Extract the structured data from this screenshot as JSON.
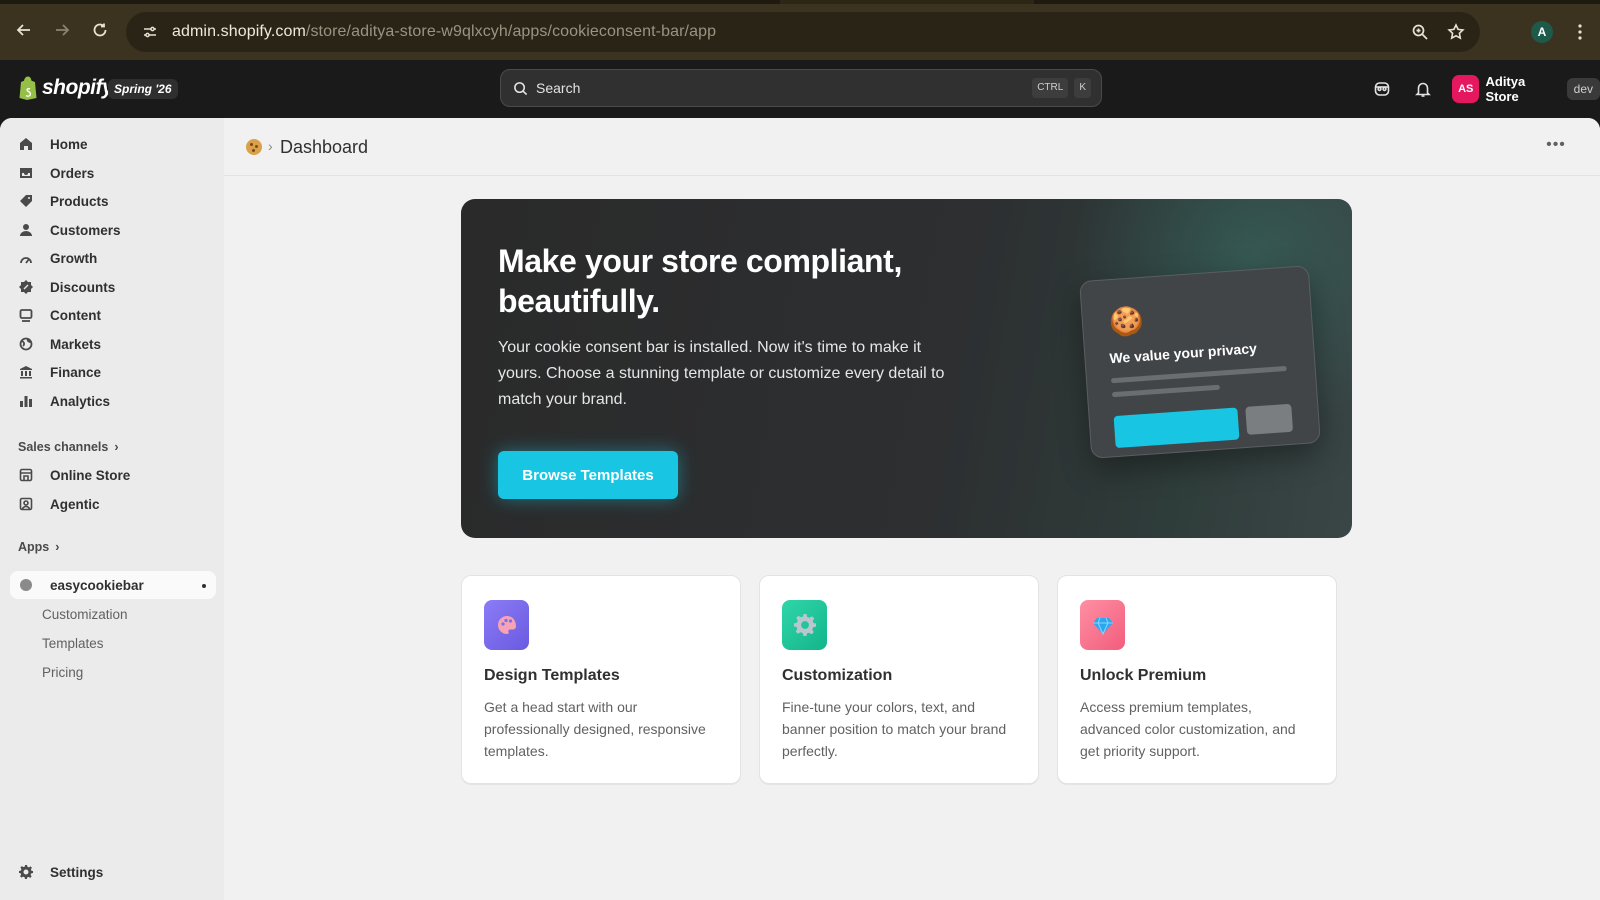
{
  "browser": {
    "url_host": "admin.shopify.com",
    "url_path": "/store/aditya-store-w9qlxcyh/apps/cookieconsent-bar/app",
    "profile_initial": "A"
  },
  "topbar": {
    "logo_text": "shopify",
    "release_badge": "Spring '26",
    "search_placeholder": "Search",
    "shortcut_keys": [
      "CTRL",
      "K"
    ],
    "store_avatar": "AS",
    "store_name": "Aditya Store",
    "store_badge": "dev"
  },
  "sidebar": {
    "items": [
      {
        "label": "Home",
        "icon": "home-icon"
      },
      {
        "label": "Orders",
        "icon": "orders-icon"
      },
      {
        "label": "Products",
        "icon": "tag-icon"
      },
      {
        "label": "Customers",
        "icon": "person-icon"
      },
      {
        "label": "Growth",
        "icon": "growth-icon"
      },
      {
        "label": "Discounts",
        "icon": "discount-icon"
      },
      {
        "label": "Content",
        "icon": "content-icon"
      },
      {
        "label": "Markets",
        "icon": "globe-icon"
      },
      {
        "label": "Finance",
        "icon": "bank-icon"
      },
      {
        "label": "Analytics",
        "icon": "bar-chart-icon"
      }
    ],
    "sales_channels_heading": "Sales channels",
    "sales_channels": [
      {
        "label": "Online Store",
        "icon": "store-icon"
      },
      {
        "label": "Agentic",
        "icon": "agentic-icon"
      }
    ],
    "apps_heading": "Apps",
    "active_app": "easycookiebar",
    "app_subitems": [
      "Customization",
      "Templates",
      "Pricing"
    ],
    "settings_label": "Settings"
  },
  "page": {
    "title": "Dashboard"
  },
  "hero": {
    "heading": "Make your store compliant, beautifully.",
    "body": "Your cookie consent bar is installed. Now it's time to make it yours. Choose a stunning template or customize every detail to match your brand.",
    "cta_label": "Browse Templates",
    "mock_title": "We value your privacy",
    "accent": "#18c6e4"
  },
  "cards": [
    {
      "title": "Design Templates",
      "description": "Get a head start with our professionally designed, responsive templates.",
      "icon": "palette-icon",
      "color": "#7b6cf0"
    },
    {
      "title": "Customization",
      "description": "Fine-tune your colors, text, and banner position to match your brand perfectly.",
      "icon": "gear-icon",
      "color": "#1fc79a"
    },
    {
      "title": "Unlock Premium",
      "description": "Access premium templates, advanced color customization, and get priority support.",
      "icon": "diamond-icon",
      "color": "#f66a86"
    }
  ]
}
